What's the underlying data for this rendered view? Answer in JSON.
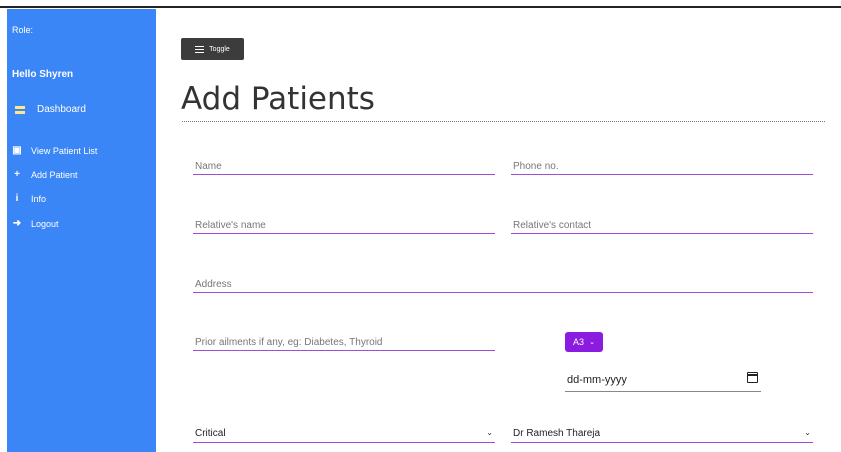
{
  "sidebar": {
    "role_label": "Role:",
    "greeting": "Hello Shyren",
    "dashboard": "Dashboard",
    "items": [
      {
        "label": "View Patient List",
        "icon": "id-card-icon",
        "glyph": "▣"
      },
      {
        "label": "Add Patient",
        "icon": "plus-icon",
        "glyph": "+"
      },
      {
        "label": "Info",
        "icon": "info-icon",
        "glyph": "i"
      },
      {
        "label": "Logout",
        "icon": "sign-out-icon",
        "glyph": "➜"
      }
    ]
  },
  "toolbar": {
    "toggle_label": "Toggle"
  },
  "page": {
    "title": "Add Patients"
  },
  "form": {
    "name_placeholder": "Name",
    "phone_placeholder": "Phone no.",
    "relative_name_placeholder": "Relative's name",
    "relative_contact_placeholder": "Relative's contact",
    "address_placeholder": "Address",
    "ailments_placeholder": "Prior ailments if any, eg: Diabetes, Thyroid",
    "ward_selected": "A3",
    "date_placeholder": "dd-mm-yyyy",
    "condition_selected": "Critical",
    "doctor_selected": "Dr Ramesh Thareja"
  },
  "colors": {
    "sidebar_bg": "#3b86f7",
    "accent_purple": "#8b1bde",
    "underline": "#a34bd9",
    "toggle_bg": "#3c3c3c"
  }
}
